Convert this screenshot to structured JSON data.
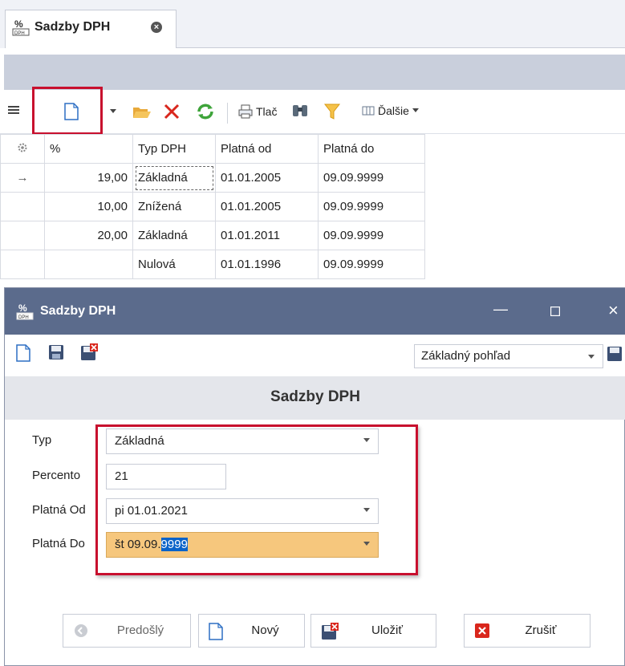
{
  "tab": {
    "title": "Sadzby DPH",
    "icon": "percent-dph-icon"
  },
  "toolbar": {
    "menu_icon": "hamburger-icon",
    "new_icon": "new-document-icon",
    "print_label": "Tlač",
    "more_label": "Ďalšie"
  },
  "grid": {
    "headers": [
      "%",
      "Typ DPH",
      "Platná od",
      "Platná do"
    ],
    "rows": [
      {
        "pct": "19,00",
        "typ": "Základná",
        "od": "01.01.2005",
        "do": "09.09.9999",
        "indicator": "→"
      },
      {
        "pct": "10,00",
        "typ": "Znížená",
        "od": "01.01.2005",
        "do": "09.09.9999",
        "indicator": ""
      },
      {
        "pct": "20,00",
        "typ": "Základná",
        "od": "01.01.2011",
        "do": "09.09.9999",
        "indicator": ""
      },
      {
        "pct": "",
        "typ": "Nulová",
        "od": "01.01.1996",
        "do": "09.09.9999",
        "indicator": ""
      }
    ]
  },
  "dialog": {
    "title": "Sadzby DPH",
    "view": "Základný pohľad",
    "header": "Sadzby DPH",
    "fields": {
      "typ_label": "Typ",
      "typ_value": "Základná",
      "percento_label": "Percento",
      "percento_value": "21",
      "od_label": "Platná Od",
      "od_value": "pi 01.01.2021",
      "do_label": "Platná Do",
      "do_value_prefix": "št 09.09.",
      "do_value_selected": "9999"
    },
    "buttons": {
      "prev": "Predošlý",
      "new": "Nový",
      "save": "Uložiť",
      "cancel": "Zrušiť"
    }
  },
  "colors": {
    "highlight": "#c8102e",
    "dialog_title": "#5b6b8c",
    "active_field": "#f6c77d",
    "selection": "#0a63c9"
  }
}
